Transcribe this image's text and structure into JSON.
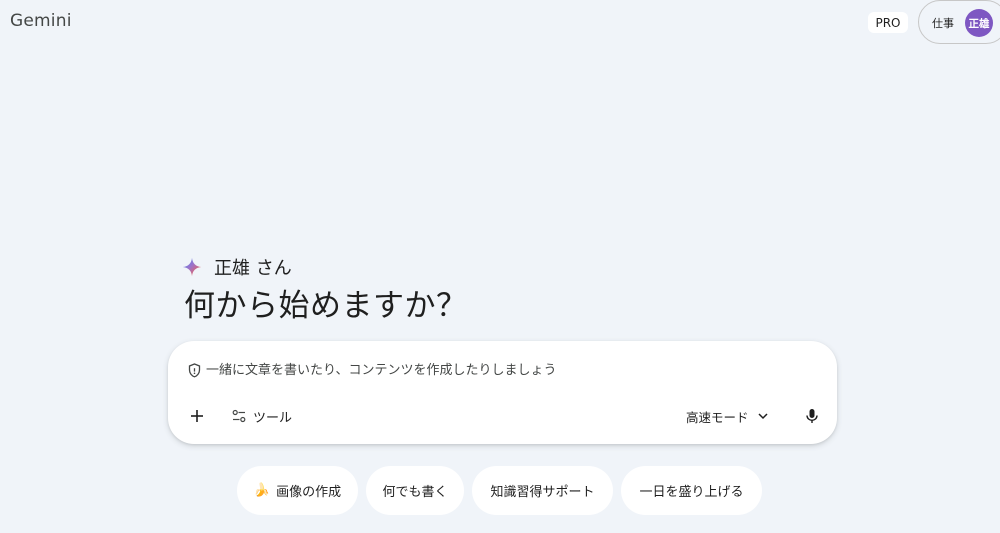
{
  "header": {
    "app_title": "Gemini",
    "pro_badge": "PRO",
    "account_label": "仕事",
    "avatar_text": "正雄"
  },
  "greeting": {
    "name_line": "正雄 さん",
    "headline": "何から始めますか？"
  },
  "prompt": {
    "placeholder": "一緒に文章を書いたり、コンテンツを作成したりしましょう",
    "value": "",
    "tools_label": "ツール",
    "mode_label": "高速モード"
  },
  "suggestions": [
    {
      "emoji": "🍌",
      "label": "画像の作成"
    },
    {
      "label": "何でも書く"
    },
    {
      "label": "知識習得サポート"
    },
    {
      "label": "一日を盛り上げる"
    }
  ],
  "colors": {
    "background": "#f0f4f9",
    "avatar": "#7e57c2",
    "surface": "#ffffff"
  },
  "icons": [
    "sparkle-icon",
    "shield-icon",
    "plus-icon",
    "tools-icon",
    "chevron-down-icon",
    "mic-icon"
  ]
}
